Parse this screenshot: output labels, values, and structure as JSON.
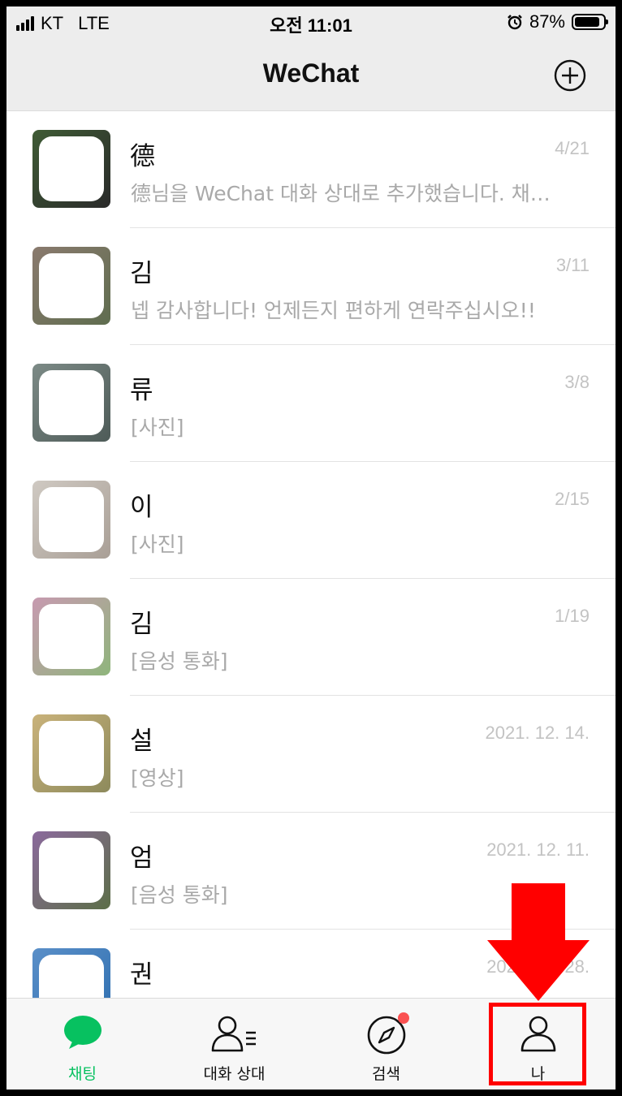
{
  "status_bar": {
    "carrier": "KT",
    "network": "LTE",
    "time": "오전 11:01",
    "battery": "87%"
  },
  "nav": {
    "title": "WeChat",
    "add_icon": "plus-circle-icon"
  },
  "chats": [
    {
      "name": "德",
      "preview": "德님을 WeChat 대화 상대로 추가했습니다. 채…",
      "time": "4/21",
      "avatar_colors": [
        "#3f5b35",
        "#2a2a2a"
      ]
    },
    {
      "name": "김",
      "preview": "넵 감사합니다! 언제든지 편하게 연락주십시오!!",
      "time": "3/11",
      "avatar_colors": [
        "#8a7a6e",
        "#5f6d4f"
      ]
    },
    {
      "name": "류",
      "preview": "[사진]",
      "time": "3/8",
      "avatar_colors": [
        "#7c8a86",
        "#4e5b58"
      ]
    },
    {
      "name": "이",
      "preview": "[사진]",
      "time": "2/15",
      "avatar_colors": [
        "#cfc9c2",
        "#a99f96"
      ]
    },
    {
      "name": "김",
      "preview": "[음성 통화]",
      "time": "1/19",
      "avatar_colors": [
        "#c79ab0",
        "#8fb57c"
      ]
    },
    {
      "name": "설",
      "preview": "[영상]",
      "time": "2021. 12. 14.",
      "avatar_colors": [
        "#c9b27a",
        "#8d8a5c"
      ]
    },
    {
      "name": "엄",
      "preview": "[음성 통화]",
      "time": "2021. 12. 11.",
      "avatar_colors": [
        "#8b6a9c",
        "#5c6e48"
      ]
    },
    {
      "name": "권",
      "preview": "",
      "time": "2021. 11. 28.",
      "avatar_colors": [
        "#5a8fc8",
        "#2f6fb0"
      ]
    }
  ],
  "tabs": [
    {
      "label": "채팅",
      "icon": "chat-bubble-icon",
      "active": true
    },
    {
      "label": "대화 상대",
      "icon": "contacts-icon",
      "active": false
    },
    {
      "label": "검색",
      "icon": "compass-icon",
      "active": false,
      "badge": true
    },
    {
      "label": "나",
      "icon": "person-icon",
      "active": false
    }
  ],
  "colors": {
    "accent": "#07c160",
    "badge": "#fa5151",
    "annotation": "#ff0000"
  }
}
